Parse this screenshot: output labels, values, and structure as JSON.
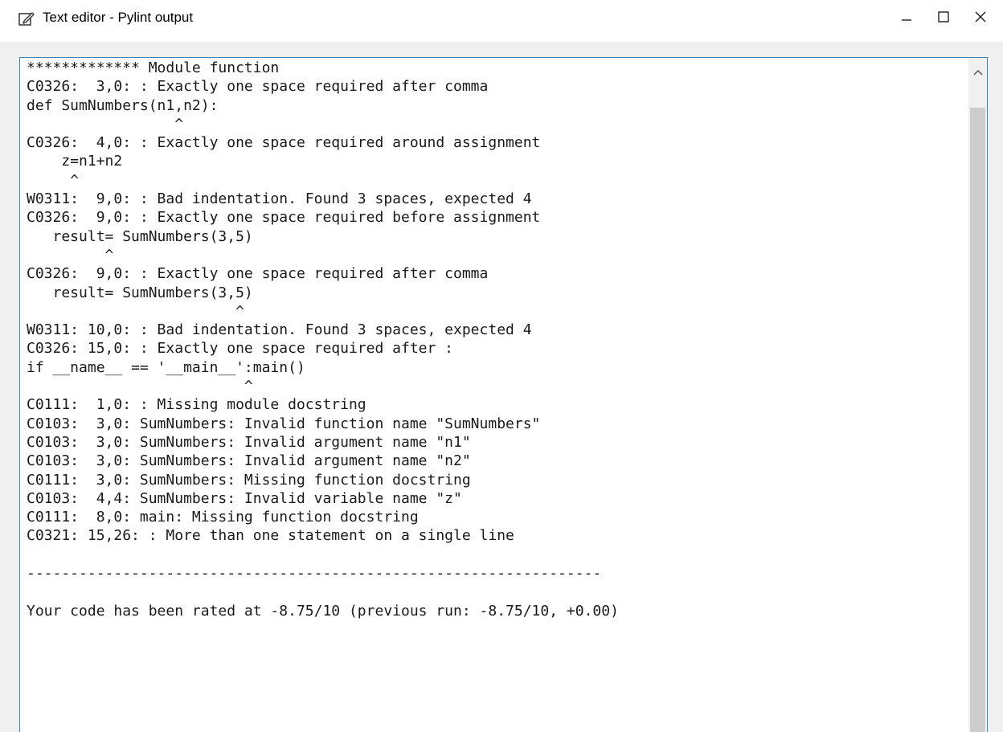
{
  "window": {
    "title": "Text editor - Pylint output",
    "icons": {
      "app": "edit-icon",
      "minimize": "minimize-icon",
      "maximize": "maximize-icon",
      "close": "close-icon",
      "scroll_up": "chevron-up-icon"
    }
  },
  "editor": {
    "lines": [
      "************* Module function",
      "C0326:  3,0: : Exactly one space required after comma",
      "def SumNumbers(n1,n2):",
      "                 ^",
      "C0326:  4,0: : Exactly one space required around assignment",
      "    z=n1+n2",
      "     ^",
      "W0311:  9,0: : Bad indentation. Found 3 spaces, expected 4",
      "C0326:  9,0: : Exactly one space required before assignment",
      "   result= SumNumbers(3,5)",
      "         ^",
      "C0326:  9,0: : Exactly one space required after comma",
      "   result= SumNumbers(3,5)",
      "                        ^",
      "W0311: 10,0: : Bad indentation. Found 3 spaces, expected 4",
      "C0326: 15,0: : Exactly one space required after :",
      "if __name__ == '__main__':main()",
      "                         ^",
      "C0111:  1,0: : Missing module docstring",
      "C0103:  3,0: SumNumbers: Invalid function name \"SumNumbers\"",
      "C0103:  3,0: SumNumbers: Invalid argument name \"n1\"",
      "C0103:  3,0: SumNumbers: Invalid argument name \"n2\"",
      "C0111:  3,0: SumNumbers: Missing function docstring",
      "C0103:  4,4: SumNumbers: Invalid variable name \"z\"",
      "C0111:  8,0: main: Missing function docstring",
      "C0321: 15,26: : More than one statement on a single line",
      "",
      "------------------------------------------------------------------",
      "",
      "Your code has been rated at -8.75/10 (previous run: -8.75/10, +0.00)"
    ]
  }
}
